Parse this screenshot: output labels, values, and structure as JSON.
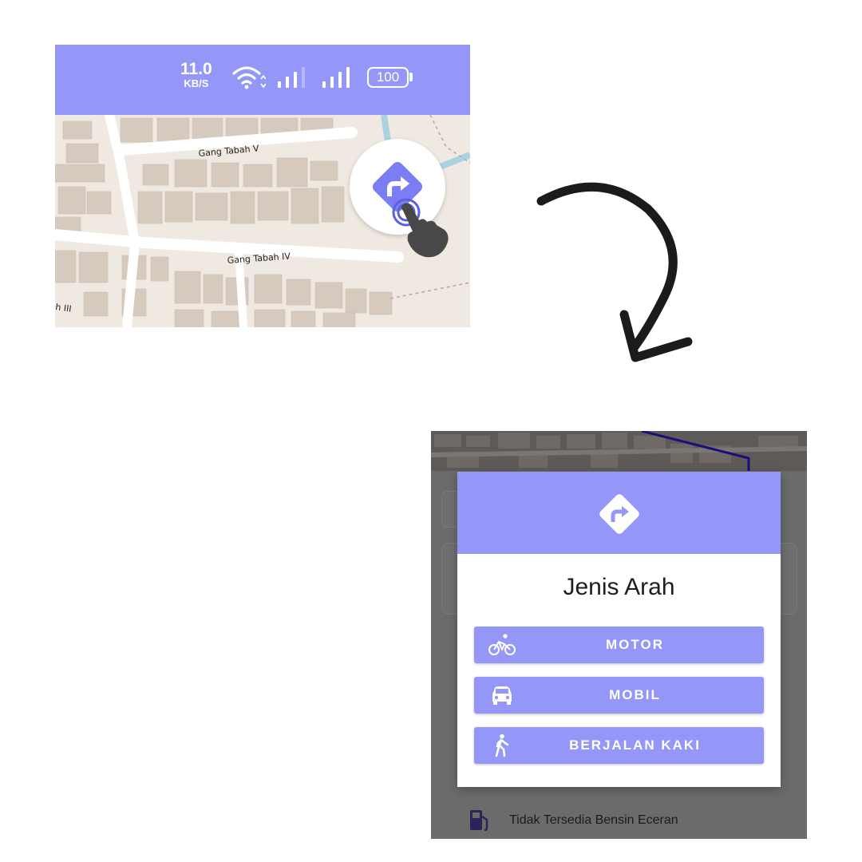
{
  "colors": {
    "accent": "#9497f8",
    "arrow": "#1b1b1b",
    "overlay": "#6b6b6b"
  },
  "status_bar": {
    "speed_value": "11.0",
    "speed_unit": "KB/S",
    "battery": "100",
    "icons": [
      "wifi-icon",
      "signal-icon",
      "signal-icon"
    ]
  },
  "map": {
    "roads": [
      "Gang Tabah V",
      "Gang Tabah IV",
      "h III"
    ],
    "route_button_icon": "turn-right-diamond-icon",
    "tap_icon": "hand-pointer-icon"
  },
  "transition_icon": "curved-arrow-icon",
  "dialog": {
    "header_icon": "turn-right-diamond-icon",
    "title": "Jenis Arah",
    "options": [
      {
        "label": "MOTOR",
        "icon": "bicycle-icon"
      },
      {
        "label": "MOBIL",
        "icon": "car-icon"
      },
      {
        "label": "BERJALAN KAKI",
        "icon": "walking-icon"
      }
    ]
  },
  "background": {
    "fuel_icon": "fuel-pump-icon",
    "fuel_text": "Tidak Tersedia Bensin Eceran"
  }
}
